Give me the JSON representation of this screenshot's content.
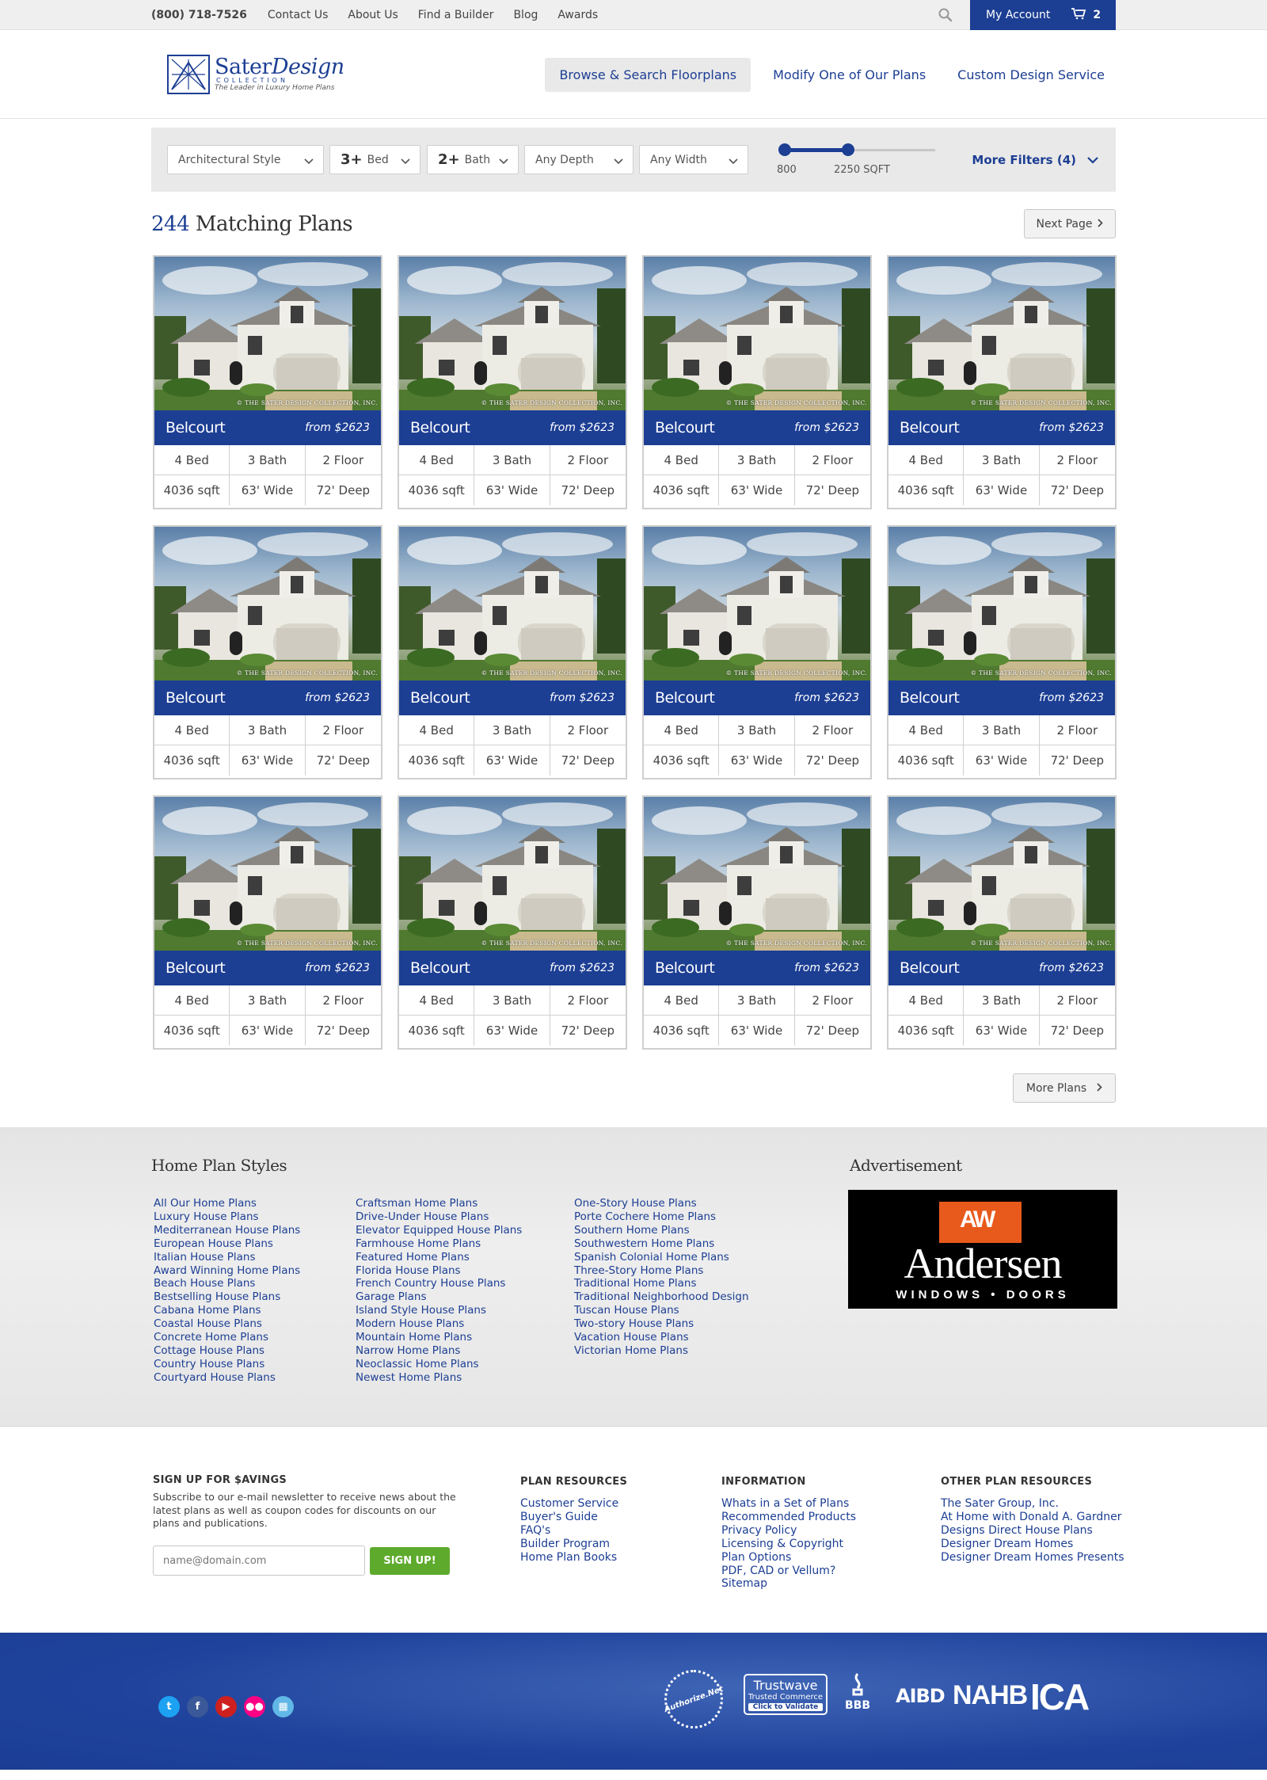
{
  "topbar": {
    "phone": "(800) 718-7526",
    "links": [
      "Contact Us",
      "About Us",
      "Find a Builder",
      "Blog",
      "Awards"
    ],
    "account": "My Account",
    "cart_count": "2"
  },
  "header": {
    "logo": {
      "brand": "Sater",
      "brand2": "Design",
      "collection": "COLLECTION",
      "tagline": "The Leader in Luxury Home Plans"
    },
    "nav": [
      "Browse & Search Floorplans",
      "Modify One of Our Plans",
      "Custom Design Service"
    ]
  },
  "filters": {
    "style": "Architectural Style",
    "bed_num": "3+",
    "bed_label": "Bed",
    "bath_num": "2+",
    "bath_label": "Bath",
    "depth": "Any Depth",
    "width": "Any Width",
    "sqft_min": "800",
    "sqft_max": "2250 SQFT",
    "more": "More Filters (4)"
  },
  "results": {
    "count": "244",
    "label": "Matching Plans",
    "next": "Next Page",
    "more": "More Plans"
  },
  "plans": [
    {
      "name": "Belcourt",
      "price": "from $2623",
      "bed": "4 Bed",
      "bath": "3 Bath",
      "floor": "2 Floor",
      "sqft": "4036 sqft",
      "wide": "63' Wide",
      "deep": "72' Deep",
      "watermark": "© THE SATER DESIGN COLLECTION, INC."
    },
    {
      "name": "Belcourt",
      "price": "from $2623",
      "bed": "4 Bed",
      "bath": "3 Bath",
      "floor": "2 Floor",
      "sqft": "4036 sqft",
      "wide": "63' Wide",
      "deep": "72' Deep",
      "watermark": "© THE SATER DESIGN COLLECTION, INC."
    },
    {
      "name": "Belcourt",
      "price": "from $2623",
      "bed": "4 Bed",
      "bath": "3 Bath",
      "floor": "2 Floor",
      "sqft": "4036 sqft",
      "wide": "63' Wide",
      "deep": "72' Deep",
      "watermark": "© THE SATER DESIGN COLLECTION, INC."
    },
    {
      "name": "Belcourt",
      "price": "from $2623",
      "bed": "4 Bed",
      "bath": "3 Bath",
      "floor": "2 Floor",
      "sqft": "4036 sqft",
      "wide": "63' Wide",
      "deep": "72' Deep",
      "watermark": "© THE SATER DESIGN COLLECTION, INC."
    },
    {
      "name": "Belcourt",
      "price": "from $2623",
      "bed": "4 Bed",
      "bath": "3 Bath",
      "floor": "2 Floor",
      "sqft": "4036 sqft",
      "wide": "63' Wide",
      "deep": "72' Deep",
      "watermark": "© THE SATER DESIGN COLLECTION, INC."
    },
    {
      "name": "Belcourt",
      "price": "from $2623",
      "bed": "4 Bed",
      "bath": "3 Bath",
      "floor": "2 Floor",
      "sqft": "4036 sqft",
      "wide": "63' Wide",
      "deep": "72' Deep",
      "watermark": "© THE SATER DESIGN COLLECTION, INC."
    },
    {
      "name": "Belcourt",
      "price": "from $2623",
      "bed": "4 Bed",
      "bath": "3 Bath",
      "floor": "2 Floor",
      "sqft": "4036 sqft",
      "wide": "63' Wide",
      "deep": "72' Deep",
      "watermark": "© THE SATER DESIGN COLLECTION, INC."
    },
    {
      "name": "Belcourt",
      "price": "from $2623",
      "bed": "4 Bed",
      "bath": "3 Bath",
      "floor": "2 Floor",
      "sqft": "4036 sqft",
      "wide": "63' Wide",
      "deep": "72' Deep",
      "watermark": "© THE SATER DESIGN COLLECTION, INC."
    },
    {
      "name": "Belcourt",
      "price": "from $2623",
      "bed": "4 Bed",
      "bath": "3 Bath",
      "floor": "2 Floor",
      "sqft": "4036 sqft",
      "wide": "63' Wide",
      "deep": "72' Deep",
      "watermark": "© THE SATER DESIGN COLLECTION, INC."
    },
    {
      "name": "Belcourt",
      "price": "from $2623",
      "bed": "4 Bed",
      "bath": "3 Bath",
      "floor": "2 Floor",
      "sqft": "4036 sqft",
      "wide": "63' Wide",
      "deep": "72' Deep",
      "watermark": "© THE SATER DESIGN COLLECTION, INC."
    },
    {
      "name": "Belcourt",
      "price": "from $2623",
      "bed": "4 Bed",
      "bath": "3 Bath",
      "floor": "2 Floor",
      "sqft": "4036 sqft",
      "wide": "63' Wide",
      "deep": "72' Deep",
      "watermark": "© THE SATER DESIGN COLLECTION, INC."
    },
    {
      "name": "Belcourt",
      "price": "from $2623",
      "bed": "4 Bed",
      "bath": "3 Bath",
      "floor": "2 Floor",
      "sqft": "4036 sqft",
      "wide": "63' Wide",
      "deep": "72' Deep",
      "watermark": "© THE SATER DESIGN COLLECTION, INC."
    }
  ],
  "styles": {
    "title": "Home Plan Styles",
    "col1": [
      "All Our Home Plans",
      "Luxury House Plans",
      "Mediterranean House Plans",
      "European House Plans",
      "Italian House Plans",
      "Award Winning Home Plans",
      "Beach House Plans",
      "Bestselling House Plans",
      "Cabana Home Plans",
      "Coastal House Plans",
      "Concrete Home Plans",
      "Cottage House Plans",
      "Country House Plans",
      "Courtyard House Plans"
    ],
    "col2": [
      "Craftsman Home Plans",
      "Drive-Under House Plans",
      "Elevator Equipped House Plans",
      "Farmhouse Home Plans",
      "Featured Home Plans",
      "Florida House Plans",
      "French Country House Plans",
      "Garage Plans",
      "Island Style House Plans",
      "Modern House Plans",
      "Mountain Home Plans",
      "Narrow Home Plans",
      "Neoclassic Home Plans",
      "Newest Home Plans"
    ],
    "col3": [
      "One-Story House Plans",
      "Porte Cochere Home Plans",
      "Southern Home Plans",
      "Southwestern Home Plans",
      "Spanish Colonial Home Plans",
      "Three-Story Home Plans",
      "Traditional Home Plans",
      "Traditional Neighborhood Design",
      "Tuscan House Plans",
      "Two-story House Plans",
      "Vacation House Plans",
      "Victorian Home Plans"
    ]
  },
  "advertisement": {
    "title": "Advertisement",
    "logo_mark": "AW",
    "brand": "Andersen",
    "sub": "WINDOWS • DOORS"
  },
  "signup": {
    "title": "SIGN UP FOR $AVINGS",
    "text": "Subscribe to our e-mail newsletter to receive news about the latest plans as well as coupon codes for discounts on our plans and publications.",
    "placeholder": "name@domain.com",
    "button": "SIGN UP!"
  },
  "plan_resources": {
    "title": "PLAN RESOURCES",
    "links": [
      "Customer Service",
      "Buyer's Guide",
      "FAQ's",
      "Builder Program",
      "Home Plan Books"
    ]
  },
  "information": {
    "title": "INFORMATION",
    "links": [
      "Whats in a Set of Plans",
      "Recommended Products",
      "Privacy Policy",
      "Licensing & Copyright",
      "Plan Options",
      "PDF, CAD or Vellum?",
      "Sitemap"
    ]
  },
  "other_resources": {
    "title": "OTHER PLAN RESOURCES",
    "links": [
      "The Sater Group, Inc.",
      "At Home with Donald A. Gardner",
      "Designs Direct House Plans",
      "Designer Dream Homes",
      "Designer Dream Homes Presents"
    ]
  },
  "badges": {
    "authorize": "Authorize.Net",
    "trustwave": "Trustwave",
    "trustwave_sub": "Trusted Commerce",
    "trustwave_click": "Click to Validate",
    "bbb": "BBB",
    "aibd": "AIBD",
    "nahb": "NAHB",
    "ica": "ICA"
  },
  "colors": {
    "brand_blue": "#1c3e93",
    "signup_green": "#5eaa2c",
    "twitter": "#1da1f2",
    "facebook": "#3b5998",
    "youtube": "#cd201f",
    "flickr": "#ff0084",
    "other": "#61b7e6"
  }
}
